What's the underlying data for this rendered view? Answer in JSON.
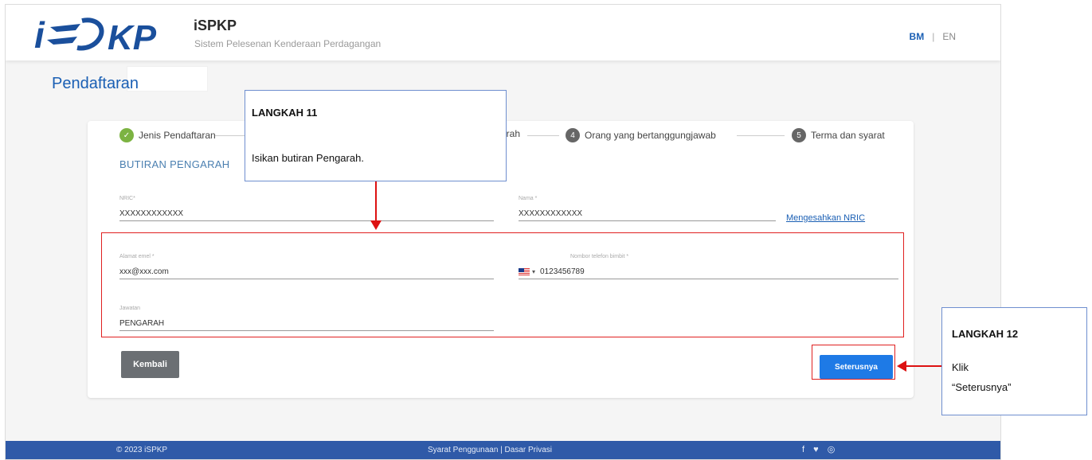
{
  "header": {
    "brand_title": "iSPKP",
    "brand_subtitle": "Sistem Pelesenan Kenderaan Perdagangan",
    "lang_bm": "BM",
    "lang_separator": "|",
    "lang_en": "EN"
  },
  "page": {
    "title": "Pendaftaran"
  },
  "stepper": {
    "steps": [
      {
        "label": "Jenis Pendaftaran",
        "status": "done"
      },
      {
        "label": "arah",
        "status": "active"
      },
      {
        "number": "4",
        "label": "Orang yang bertanggungjawab",
        "status": "pending"
      },
      {
        "number": "5",
        "label": "Terma dan syarat",
        "status": "pending"
      }
    ]
  },
  "form": {
    "section_title": "BUTIRAN PENGARAH",
    "nric": {
      "label": "NRIC*",
      "value": "XXXXXXXXXXXX"
    },
    "nama": {
      "label": "Nama *",
      "value": "XXXXXXXXXXXX"
    },
    "verify_link": "Mengesahkan NRIC",
    "email": {
      "label": "Alamat emel *",
      "value": "xxx@xxx.com"
    },
    "phone": {
      "label": "Nombor telefon bimbit *",
      "value": "0123456789"
    },
    "jawatan": {
      "label": "Jawatan",
      "value": "PENGARAH"
    }
  },
  "buttons": {
    "back": "Kembali",
    "next": "Seterusnya"
  },
  "footer": {
    "copyright": "© 2023 iSPKP",
    "links": "Syarat Penggunaan | Dasar Privasi",
    "social": "f ♥ ◎"
  },
  "annotations": {
    "step11": {
      "heading": "LANGKAH 11",
      "text": "Isikan butiran Pengarah."
    },
    "step12": {
      "heading": "LANGKAH 12",
      "text_line1": "Klik",
      "text_line2": "“Seterusnya”"
    }
  },
  "colors": {
    "accent": "#1a5fb4",
    "primary_button": "#1e7ae6",
    "footer": "#2f5aa8",
    "annotation_red": "#e02020"
  }
}
